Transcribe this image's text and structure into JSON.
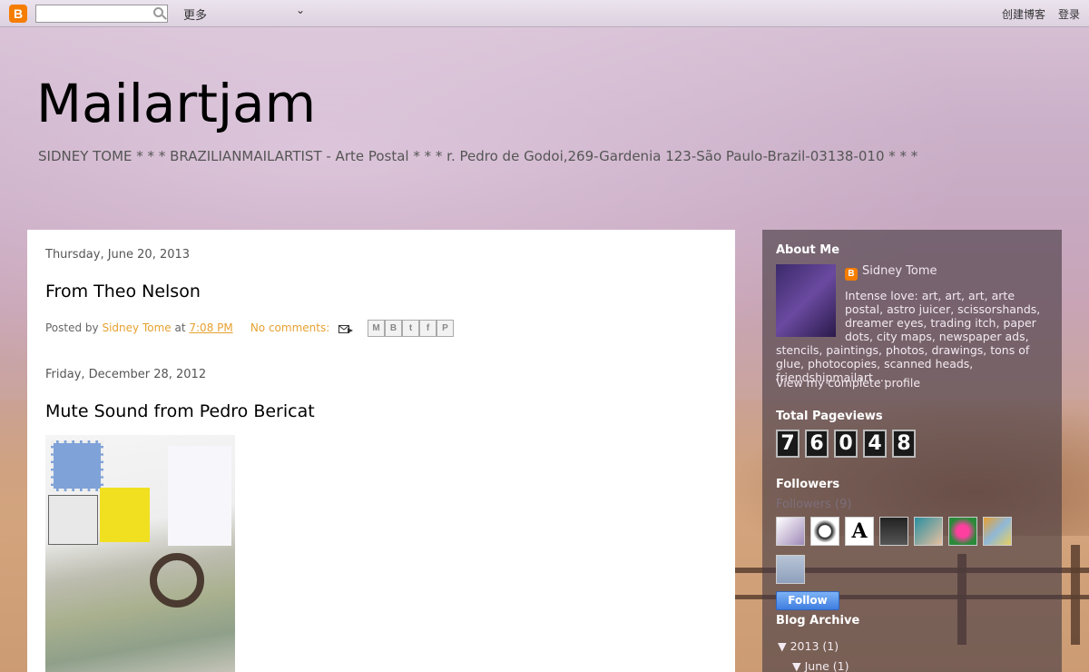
{
  "navbar": {
    "more_label": "更多",
    "create_blog": "创建博客",
    "login": "登录"
  },
  "header": {
    "title": "Mailartjam",
    "description": "SIDNEY TOME * * * BRAZILIANMAILARTIST - Arte Postal * * * r. Pedro de Godoi,269-Gardenia 123-São Paulo-Brazil-03138-010 * * *"
  },
  "posts": [
    {
      "date": "Thursday, June 20, 2013",
      "title": "From Theo Nelson",
      "posted_by": "Posted by",
      "author": "Sidney Tome",
      "at": "at",
      "time": "7:08 PM",
      "comments": "No comments:"
    },
    {
      "date": "Friday, December 28, 2012",
      "title": "Mute Sound from Pedro Bericat"
    }
  ],
  "share_buttons": [
    "M",
    "B",
    "t",
    "f",
    "P"
  ],
  "sidebar": {
    "about_title": "About Me",
    "profile_name": "Sidney Tome",
    "profile_line1": "Intense love: art, art, art, arte",
    "profile_line2": "postal, astro juicer, scissorshands,",
    "profile_line3": "dreamer eyes, trading itch, paper",
    "profile_line4": "dots, city maps, newspaper ads,",
    "profile_rest": "stencils, paintings, photos, drawings, tons of glue, photocopies, scanned heads, friendshipmailart ...",
    "view_profile": "View my complete profile",
    "pageviews_title": "Total Pageviews",
    "pageview_digits": [
      "7",
      "6",
      "0",
      "4",
      "8"
    ],
    "followers_title": "Followers",
    "followers_count": "Followers (9)",
    "follow_button": "Follow",
    "archive_title": "Blog Archive",
    "archive_year": "▼  2013 (1)",
    "archive_month": "▼  June (1)"
  },
  "colors": {
    "link": "#e6a131",
    "follow_button": "#4a86e8",
    "blogger_orange": "#f57d00"
  }
}
